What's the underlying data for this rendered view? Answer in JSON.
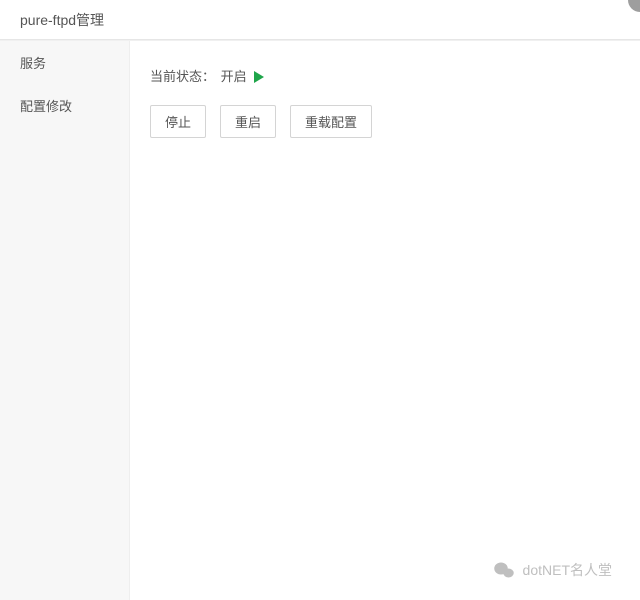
{
  "header": {
    "title": "pure-ftpd管理"
  },
  "sidebar": {
    "items": [
      {
        "label": "服务",
        "active": true
      },
      {
        "label": "配置修改",
        "active": false
      }
    ]
  },
  "main": {
    "status_label": "当前状态：",
    "status_value": "开启",
    "status_color": "#1fa54a",
    "buttons": {
      "stop_label": "停止",
      "restart_label": "重启",
      "reload_label": "重载配置"
    }
  },
  "watermark": {
    "text": "dotNET名人堂",
    "icon": "wechat-icon"
  }
}
